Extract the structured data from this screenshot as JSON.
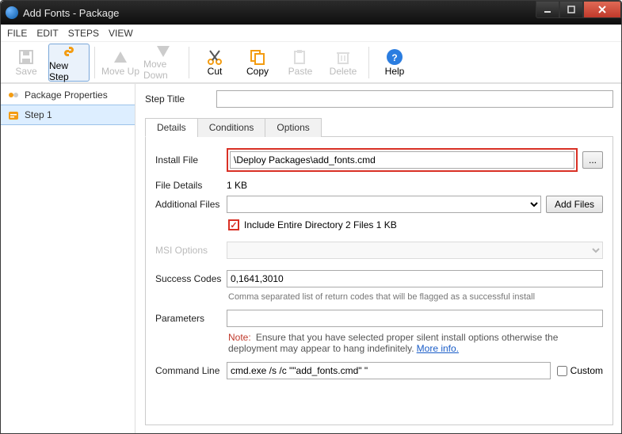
{
  "window": {
    "title": "Add Fonts - Package"
  },
  "menu": [
    "FILE",
    "EDIT",
    "STEPS",
    "VIEW"
  ],
  "toolbar": {
    "save": "Save",
    "newstep": "New Step",
    "moveup": "Move Up",
    "movedown": "Move Down",
    "cut": "Cut",
    "copy": "Copy",
    "paste": "Paste",
    "delete": "Delete",
    "help": "Help"
  },
  "sidebar": [
    "Package Properties",
    "Step 1"
  ],
  "tabs": [
    "Details",
    "Conditions",
    "Options"
  ],
  "labels": {
    "step_title": "Step Title",
    "install_file": "Install File",
    "file_details": "File Details",
    "additional_files": "Additional Files",
    "add_files": "Add Files",
    "msi_options": "MSI Options",
    "success_codes": "Success Codes",
    "parameters": "Parameters",
    "command_line": "Command Line",
    "custom": "Custom",
    "browse": "..."
  },
  "fields": {
    "step_title": "",
    "install_file": "\\Deploy Packages\\add_fonts.cmd",
    "file_details": "1 KB",
    "include_dir": "Include Entire Directory  2 Files  1 KB",
    "success_codes": "0,1641,3010",
    "parameters": "",
    "command_line": "cmd.exe /s /c \"\"add_fonts.cmd\" \""
  },
  "help": {
    "success_codes": "Comma separated list of return codes that will be flagged as a successful install",
    "note_label": "Note:",
    "parameters": "Ensure that you have selected proper silent install options otherwise the deployment may appear to hang indefinitely.",
    "more_info": "More info."
  }
}
